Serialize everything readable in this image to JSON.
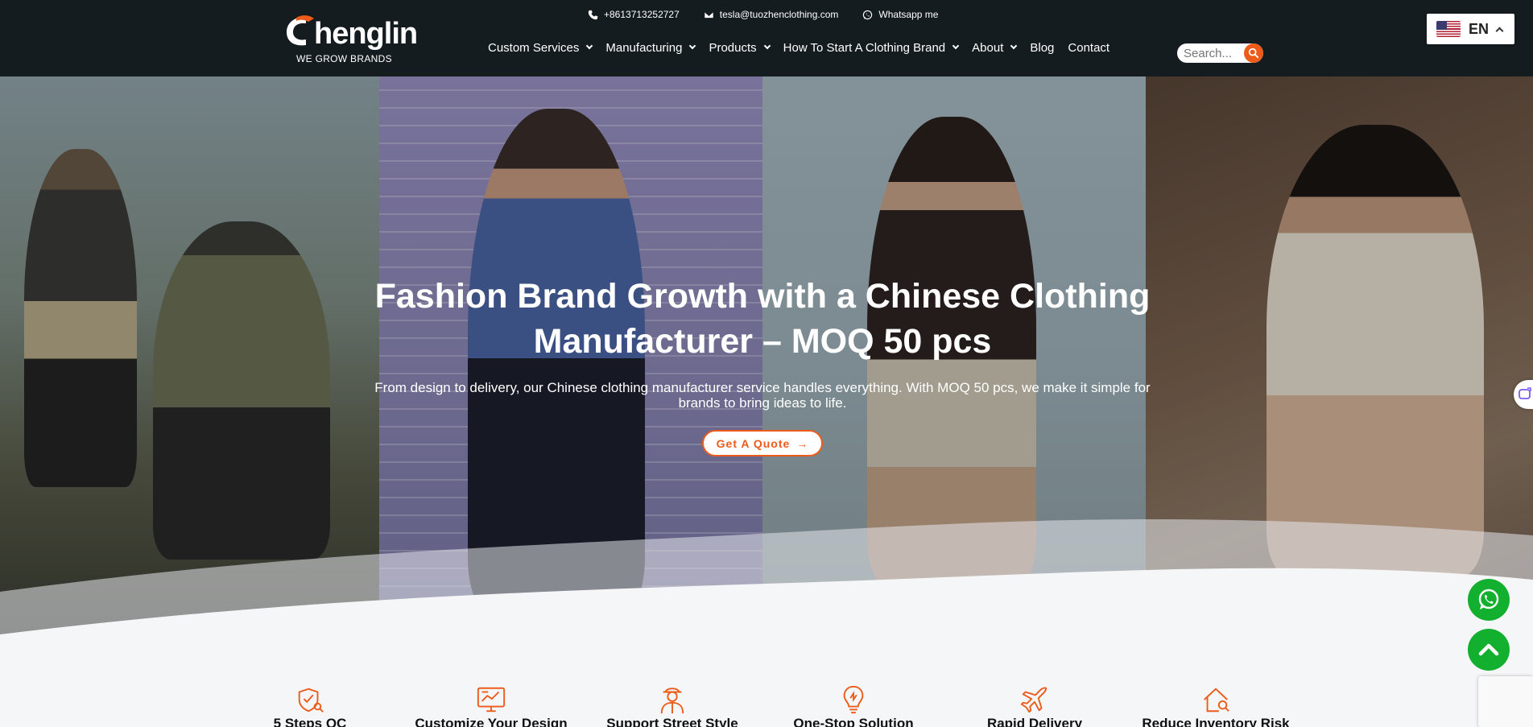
{
  "brand": {
    "name": "henglin",
    "tagline": "WE GROW BRANDS"
  },
  "topbar": {
    "phone": "+8613713252727",
    "email": "tesla@tuozhenclothing.com",
    "whatsapp": "Whatsapp me"
  },
  "nav": {
    "items": [
      {
        "label": "Custom Services",
        "dropdown": true
      },
      {
        "label": "Manufacturing",
        "dropdown": true
      },
      {
        "label": "Products",
        "dropdown": true
      },
      {
        "label": "How To Start A Clothing Brand",
        "dropdown": true
      },
      {
        "label": "About",
        "dropdown": true
      },
      {
        "label": "Blog",
        "dropdown": false
      },
      {
        "label": "Contact",
        "dropdown": false
      }
    ]
  },
  "search": {
    "placeholder": "Search..."
  },
  "language": {
    "code": "EN",
    "flag": "us-flag"
  },
  "hero": {
    "title_line1": "Fashion Brand Growth with a Chinese Clothing",
    "title_line2": "Manufacturer – MOQ 50 pcs",
    "subtitle_line1": "From design to delivery, our Chinese clothing manufacturer service handles everything. With MOQ 50 pcs, we make it simple for",
    "subtitle_line2": "brands to bring ideas to life.",
    "cta_label": "Get A Quote",
    "cta_arrow": "→"
  },
  "features": [
    {
      "label": "5 Steps QC",
      "icon": "shield-check-icon"
    },
    {
      "label": "Customize Your Design",
      "icon": "monitor-chart-icon"
    },
    {
      "label": "Support Street Style",
      "icon": "designer-person-icon"
    },
    {
      "label": "One-Stop Solution",
      "icon": "lightbulb-icon"
    },
    {
      "label": "Rapid Delivery",
      "icon": "airplane-icon"
    },
    {
      "label": "Reduce Inventory Risk",
      "icon": "house-search-icon"
    }
  ],
  "colors": {
    "header_bg": "#151c20",
    "accent": "#ec5b1a",
    "whatsapp_green": "#12b02e",
    "page_bg": "#f5f6f8"
  }
}
